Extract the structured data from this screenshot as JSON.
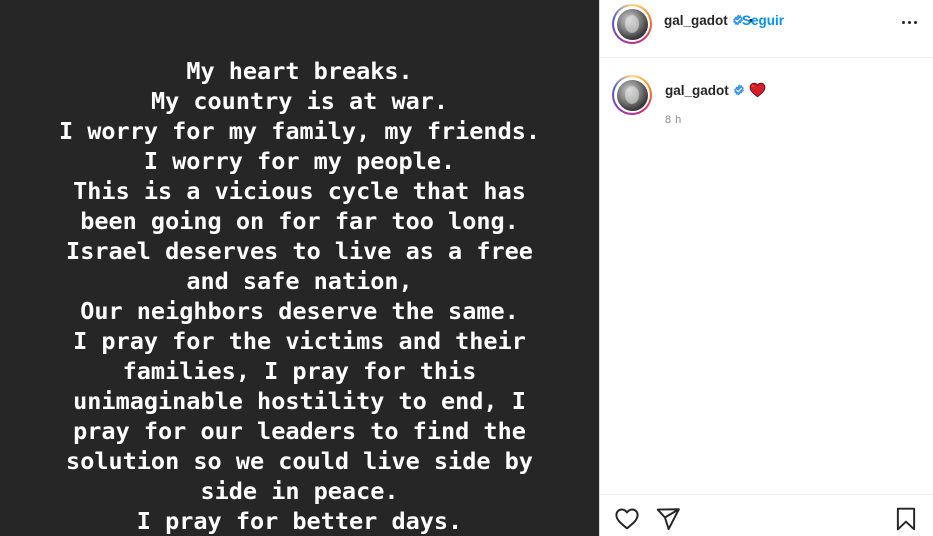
{
  "story": {
    "lines": [
      "My heart breaks.",
      "My country is at war.",
      "I worry for my family, my friends.",
      "I worry for my people.",
      "This is a vicious cycle that has",
      "been going on for far too long.",
      "Israel deserves to live as a free",
      "and safe nation,",
      "Our neighbors deserve the same.",
      "I pray for the victims and their",
      "families, I pray for this",
      "unimaginable hostility to end, I",
      "pray for our leaders to find the",
      "solution so we could live side by",
      "side in peace.",
      "I pray for better days."
    ]
  },
  "header": {
    "username": "gal_gadot",
    "separator": "•",
    "follow_label": "Seguir",
    "more_icon": "more-horizontal-icon",
    "verified_icon": "verified-badge-icon"
  },
  "caption": {
    "username": "gal_gadot",
    "emoji": "red-heart-icon",
    "time": "8 h"
  },
  "actions": {
    "like_icon": "heart-outline-icon",
    "share_icon": "paper-plane-icon",
    "save_icon": "bookmark-icon"
  },
  "colors": {
    "media_bg": "#262626",
    "accent": "#0095f6",
    "verified": "#3897f0",
    "text": "#262626",
    "muted": "#8e8e8e",
    "heart": "#ed4956"
  }
}
